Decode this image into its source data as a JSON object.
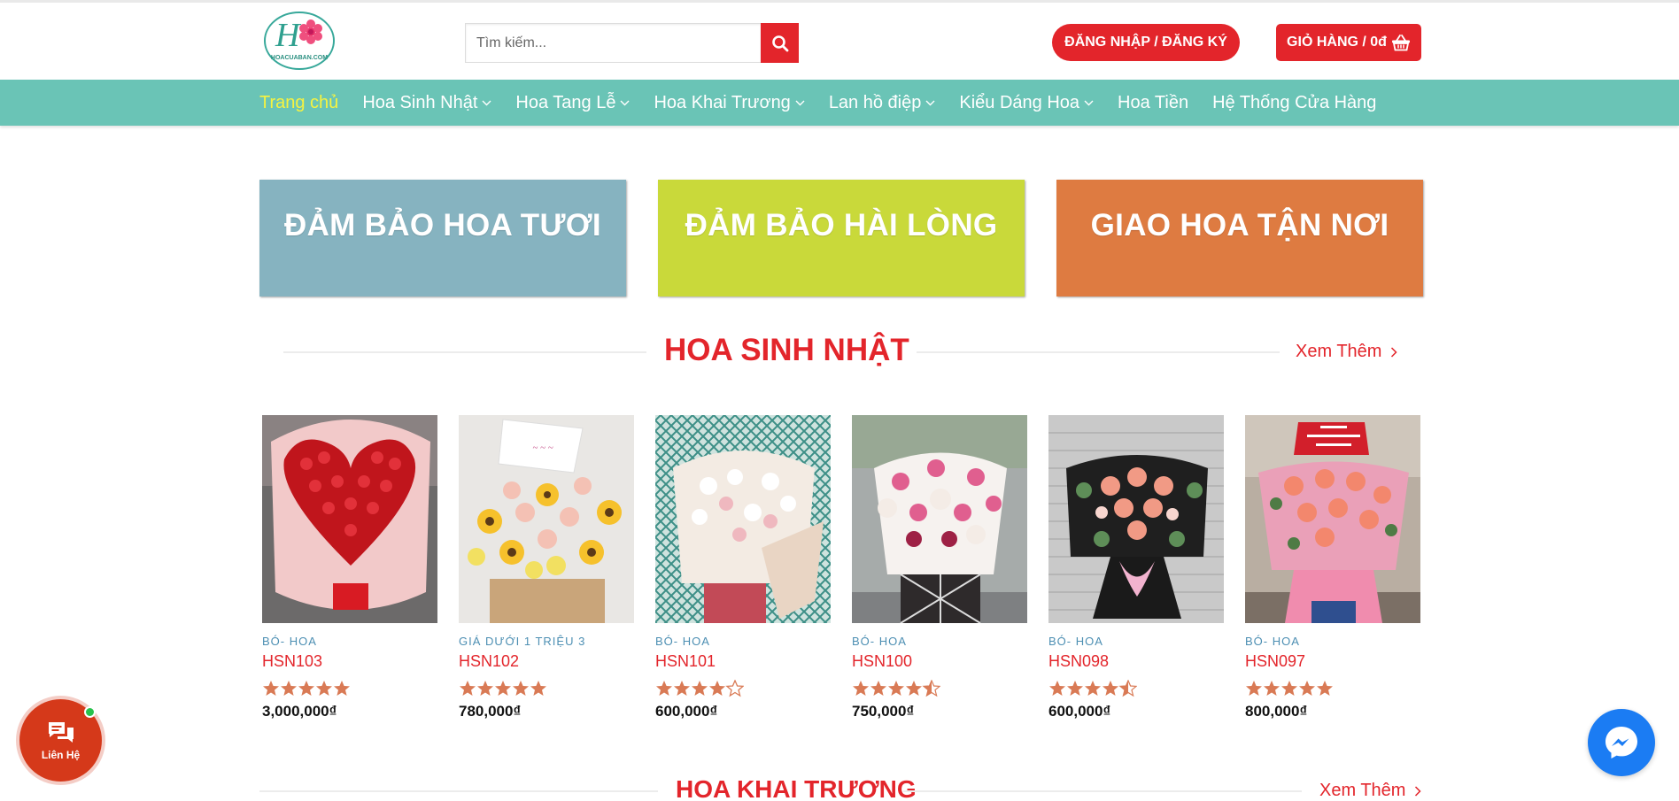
{
  "header": {
    "logo_text": "HOACUABAN.COM",
    "search_placeholder": "Tìm kiếm...",
    "login_label": "ĐĂNG NHẬP / ĐĂNG KÝ",
    "cart_label": "GIỎ HÀNG / 0đ"
  },
  "nav": {
    "items": [
      {
        "label": "Trang chủ"
      },
      {
        "label": "Hoa Sinh Nhật"
      },
      {
        "label": "Hoa Tang Lễ"
      },
      {
        "label": "Hoa Khai Trương"
      },
      {
        "label": "Lan hồ điệp"
      },
      {
        "label": "Kiểu Dáng Hoa"
      },
      {
        "label": "Hoa Tiền"
      },
      {
        "label": "Hệ Thống Cửa Hàng"
      }
    ]
  },
  "banners": [
    {
      "label": "ĐẢM BẢO HOA TƯƠI"
    },
    {
      "label": "ĐẢM BẢO HÀI LÒNG"
    },
    {
      "label": "GIAO HOA TẬN NƠI"
    }
  ],
  "sections": [
    {
      "title": "HOA SINH NHẬT",
      "see_more": "Xem Thêm"
    },
    {
      "title": "HOA KHAI TRƯƠNG",
      "see_more": "Xem Thêm"
    }
  ],
  "products": [
    {
      "category": "BÓ- HOA",
      "name": "HSN103",
      "price": "3,000,000₫",
      "rating": 5
    },
    {
      "category": "GIÁ DƯỚI 1 TRIỆU 3",
      "name": "HSN102",
      "price": "780,000₫",
      "rating": 5
    },
    {
      "category": "BÓ- HOA",
      "name": "HSN101",
      "price": "600,000₫",
      "rating": 4
    },
    {
      "category": "BÓ- HOA",
      "name": "HSN100",
      "price": "750,000₫",
      "rating": 4.5
    },
    {
      "category": "BÓ- HOA",
      "name": "HSN098",
      "price": "600,000₫",
      "rating": 4.5
    },
    {
      "category": "BÓ- HOA",
      "name": "HSN097",
      "price": "800,000₫",
      "rating": 5
    }
  ],
  "contact": {
    "label": "Liên Hệ"
  },
  "colors": {
    "brand_red": "#e3252b",
    "nav_teal": "#6ac4b6",
    "nav_active": "#f6f340",
    "star": "#d97a55"
  }
}
